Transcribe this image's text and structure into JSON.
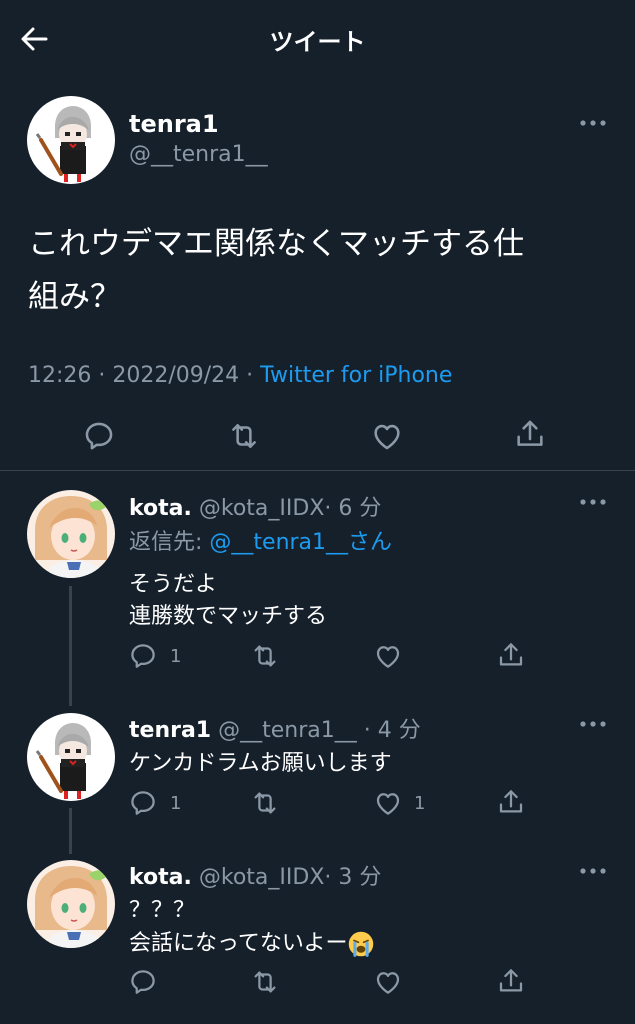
{
  "header": {
    "title": "ツイート",
    "back_icon": "arrow-left-icon"
  },
  "main_tweet": {
    "name": "tenra1",
    "handle": "@__tenra1__",
    "text_line1": "これウデマエ関係なくマッチする仕",
    "text_line2": "組み？",
    "time": "12:26 · 2022/09/24 · ",
    "source": "Twitter for iPhone"
  },
  "replies": [
    {
      "name": "kota.",
      "handle": "@kota_IIDX",
      "time": "· 6 分",
      "reply_to_prefix": "返信先: ",
      "reply_to_mention": "@__tenra1__",
      "reply_to_suffix": "さん",
      "line1": "そうだよ",
      "line2": "連勝数でマッチする",
      "reply_count": "1",
      "like_count": ""
    },
    {
      "name": "tenra1",
      "handle": "@__tenra1__",
      "time": "· 4 分",
      "line1": "ケンカドラムお願いします",
      "reply_count": "1",
      "like_count": "1"
    },
    {
      "name": "kota.",
      "handle": "@kota_IIDX",
      "time": "· 3 分",
      "line1": "？？？",
      "line2": "会話になってないよー",
      "emoji": "loudly-crying-face",
      "reply_count": "",
      "like_count": ""
    }
  ],
  "colors": {
    "background": "#15202b",
    "accent": "#1d9bf0",
    "secondary_text": "#8b98a5",
    "divider": "#38444d"
  }
}
